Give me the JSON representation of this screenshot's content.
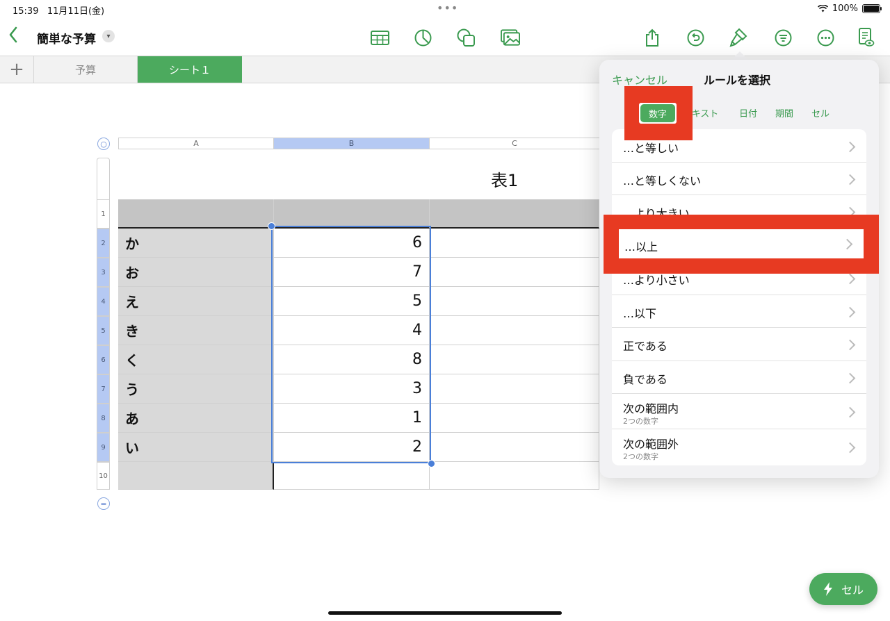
{
  "status_bar": {
    "time": "15:39",
    "date": "11月11日(金)",
    "battery": "100%"
  },
  "toolbar": {
    "back_icon": "chevron-left-icon",
    "doc_title": "簡単な予算",
    "center_icons": [
      "table-icon",
      "chart-icon",
      "shapes-icon",
      "media-icon"
    ],
    "right_icons": [
      "share-icon",
      "undo-icon",
      "format-brush-icon",
      "organize-icon",
      "more-icon",
      "reader-icon"
    ]
  },
  "sheet_tabs": [
    {
      "label": "予算",
      "active": false
    },
    {
      "label": "シート１",
      "active": true
    }
  ],
  "spreadsheet": {
    "columns": [
      "A",
      "B",
      "C"
    ],
    "table_title": "表1",
    "row_numbers": [
      "1",
      "2",
      "3",
      "4",
      "5",
      "6",
      "7",
      "8",
      "9",
      "10"
    ],
    "rows": [
      {
        "key": "か",
        "value": "6"
      },
      {
        "key": "お",
        "value": "7"
      },
      {
        "key": "え",
        "value": "5"
      },
      {
        "key": "き",
        "value": "4"
      },
      {
        "key": "く",
        "value": "8"
      },
      {
        "key": "う",
        "value": "3"
      },
      {
        "key": "あ",
        "value": "1"
      },
      {
        "key": "い",
        "value": "2"
      }
    ]
  },
  "popover": {
    "cancel": "キャンセル",
    "title": "ルールを選択",
    "segments": [
      "数字",
      "テキスト",
      "日付",
      "期間",
      "セル"
    ],
    "segment_visible": [
      "数字",
      "キスト",
      "日付",
      "期間",
      "セル"
    ],
    "selected_segment": "数字",
    "rules": [
      {
        "label": "…と等しい"
      },
      {
        "label": "…と等しくない"
      },
      {
        "label": "…より大きい"
      },
      {
        "label": "…以上"
      },
      {
        "label": "…より小さい"
      },
      {
        "label": "…以下"
      },
      {
        "label": "正である"
      },
      {
        "label": "負である"
      },
      {
        "label": "次の範囲内",
        "sub": "2つの数字"
      },
      {
        "label": "次の範囲外",
        "sub": "2つの数字"
      }
    ]
  },
  "cell_button": {
    "label": "セル",
    "icon": "lightning-icon"
  },
  "colors": {
    "accent": "#4caa5e",
    "highlight": "#e73a22",
    "selection": "#4a7fd8"
  }
}
